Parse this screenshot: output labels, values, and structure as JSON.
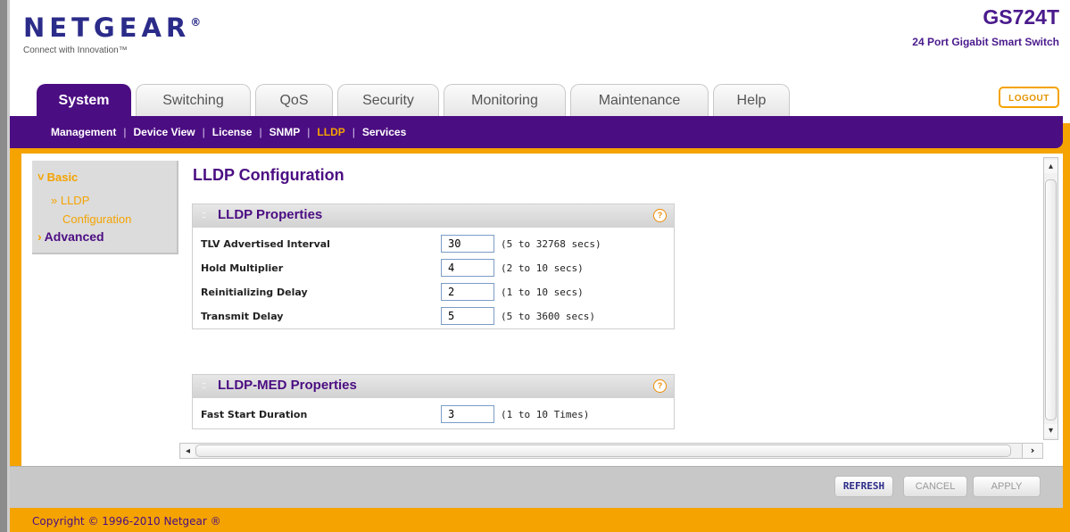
{
  "header": {
    "brand": "NETGEAR",
    "brand_mark": "®",
    "tagline": "Connect with Innovation™",
    "model": "GS724T",
    "model_desc": "24 Port Gigabit Smart Switch",
    "logout_label": "LOGOUT"
  },
  "tabs": [
    {
      "label": "System",
      "active": true
    },
    {
      "label": "Switching"
    },
    {
      "label": "QoS"
    },
    {
      "label": "Security"
    },
    {
      "label": "Monitoring"
    },
    {
      "label": "Maintenance"
    },
    {
      "label": "Help"
    }
  ],
  "subnav": [
    {
      "label": "Management"
    },
    {
      "label": "Device View"
    },
    {
      "label": "License"
    },
    {
      "label": "SNMP"
    },
    {
      "label": "LLDP",
      "active": true
    },
    {
      "label": "Services"
    }
  ],
  "sidebar": {
    "basic": "Basic",
    "lldp_line1": "» LLDP",
    "lldp_line2": "Configuration",
    "advanced": "Advanced"
  },
  "page_title": "LLDP Configuration",
  "panels": {
    "lldp": {
      "title": "LLDP Properties",
      "rows": [
        {
          "label": "TLV Advertised Interval",
          "value": "30",
          "range": "(5 to 32768 secs)"
        },
        {
          "label": "Hold Multiplier",
          "value": "4",
          "range": "(2 to 10 secs)"
        },
        {
          "label": "Reinitializing Delay",
          "value": "2",
          "range": "(1 to 10 secs)"
        },
        {
          "label": "Transmit Delay",
          "value": "5",
          "range": "(5 to 3600 secs)"
        }
      ]
    },
    "med": {
      "title": "LLDP-MED Properties",
      "rows": [
        {
          "label": "Fast Start Duration",
          "value": "3",
          "range": "(1 to 10 Times)"
        }
      ]
    }
  },
  "buttons": {
    "refresh": "REFRESH",
    "cancel": "CANCEL",
    "apply": "APPLY"
  },
  "footer": {
    "copyright": "Copyright © 1996-2010 Netgear ®"
  },
  "icons": {
    "help": "help-icon",
    "scroll_up": "chevron-up-icon",
    "scroll_down": "chevron-down-icon",
    "scroll_left": "chevron-left-icon",
    "scroll_right": "chevron-right-icon"
  },
  "colors": {
    "purple": "#4b0d82",
    "orange": "#f4a300"
  }
}
